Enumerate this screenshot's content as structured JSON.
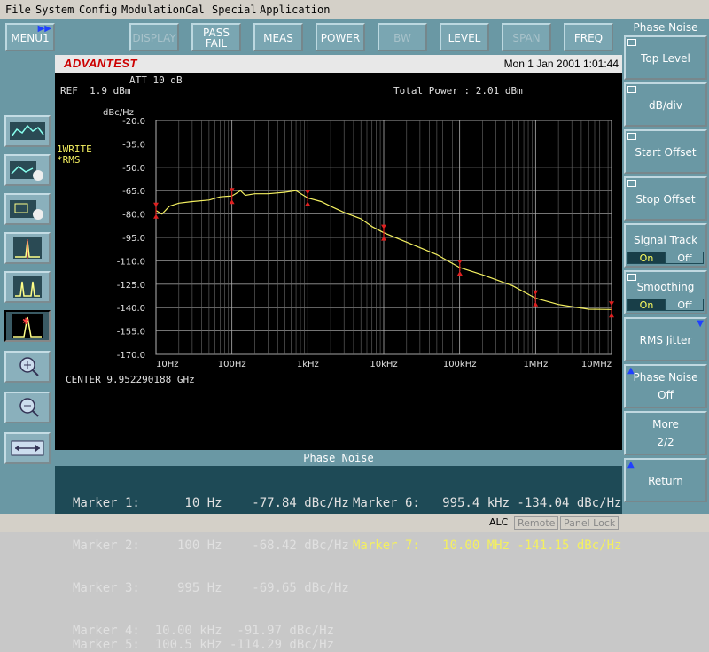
{
  "menubar": {
    "items": [
      "File",
      "System",
      "Config",
      "Modulation",
      "Cal",
      "Special",
      "Application"
    ]
  },
  "toolbar": {
    "menu1": "MENU1",
    "display": "DISPLAY",
    "passfail_line1": "PASS",
    "passfail_line2": "FAIL",
    "meas": "MEAS",
    "power": "POWER",
    "bw": "BW",
    "level": "LEVEL",
    "span": "SPAN",
    "freq": "FREQ"
  },
  "header": {
    "brand": "ADVANTEST",
    "datetime": "Mon 1  Jan 2001 1:01:44"
  },
  "screen": {
    "att": "ATT 10 dB",
    "ref": "REF  1.9 dBm",
    "total_power": "Total Power : 2.01 dBm",
    "trace_mode_line1": "1WRITE",
    "trace_mode_line2": "*RMS",
    "center": "CENTER 9.952290188 GHz"
  },
  "chart_data": {
    "type": "line",
    "ylabel": "dBc/Hz",
    "x_scale": "log",
    "xlim": [
      10,
      10000000
    ],
    "ylim": [
      -170,
      -20
    ],
    "x_ticks": [
      10,
      100,
      1000,
      10000,
      100000,
      1000000,
      10000000
    ],
    "x_tick_labels": [
      "10Hz",
      "100Hz",
      "1kHz",
      "10kHz",
      "100kHz",
      "1MHz",
      "10MHz"
    ],
    "y_ticks": [
      -20,
      -35,
      -50,
      -65,
      -80,
      -95,
      -110,
      -125,
      -140,
      -155,
      -170
    ],
    "y_tick_labels": [
      "-20.0",
      "-35.0",
      "-50.0",
      "-65.0",
      "-80.0",
      "-95.0",
      "-110.0",
      "-125.0",
      "-140.0",
      "-155.0",
      "-170.0"
    ],
    "grid": true,
    "series": [
      {
        "color": "#f4f060",
        "x": [
          10,
          12,
          15,
          20,
          30,
          50,
          70,
          100,
          130,
          150,
          200,
          300,
          500,
          700,
          1000,
          1500,
          2000,
          3000,
          5000,
          7000,
          10000,
          20000,
          50000,
          100000,
          200000,
          500000,
          1000000,
          2000000,
          5000000,
          10000000
        ],
        "y": [
          -77.8,
          -80,
          -75,
          -73,
          -72,
          -71,
          -69,
          -68.4,
          -65,
          -68,
          -67,
          -67,
          -66,
          -65,
          -69.7,
          -72,
          -75,
          -79,
          -83,
          -88,
          -92,
          -98,
          -106,
          -114.3,
          -119,
          -126,
          -134,
          -138,
          -141,
          -141.2
        ]
      }
    ],
    "markers": [
      {
        "x": 10,
        "y": -77.84
      },
      {
        "x": 100,
        "y": -68.42
      },
      {
        "x": 995,
        "y": -69.65
      },
      {
        "x": 10000,
        "y": -91.97
      },
      {
        "x": 100500,
        "y": -114.29
      },
      {
        "x": 995400,
        "y": -134.04
      },
      {
        "x": 10000000,
        "y": -141.15
      }
    ],
    "marker_color": "#e02020"
  },
  "panel": {
    "title": "Phase Noise",
    "markers": [
      {
        "text": "Marker 1:      10 Hz    -77.84 dBc/Hz"
      },
      {
        "text": "Marker 2:     100 Hz    -68.42 dBc/Hz"
      },
      {
        "text": "Marker 3:     995 Hz    -69.65 dBc/Hz"
      },
      {
        "text": "Marker 4:  10.00 kHz  -91.97 dBc/Hz"
      },
      {
        "text": "Marker 5:  100.5 kHz -114.29 dBc/Hz"
      },
      {
        "text": "Marker 6:   995.4 kHz -134.04 dBc/Hz"
      },
      {
        "text": "Marker 7:   10.00 MHz -141.15 dBc/Hz"
      }
    ]
  },
  "softkeys": {
    "title": "Phase Noise",
    "top_level": "Top Level",
    "db_div": "dB/div",
    "start_offset": "Start Offset",
    "stop_offset": "Stop Offset",
    "signal_track": "Signal Track",
    "smoothing": "Smoothing",
    "on": "On",
    "off": "Off",
    "rms_jitter": "RMS Jitter",
    "phase_noise_label": "Phase Noise",
    "phase_noise_value": "Off",
    "more": "More",
    "more_page": "2/2",
    "return": "Return"
  },
  "statusbar": {
    "alc": "ALC",
    "remote": "Remote",
    "panel_lock": "Panel Lock"
  }
}
